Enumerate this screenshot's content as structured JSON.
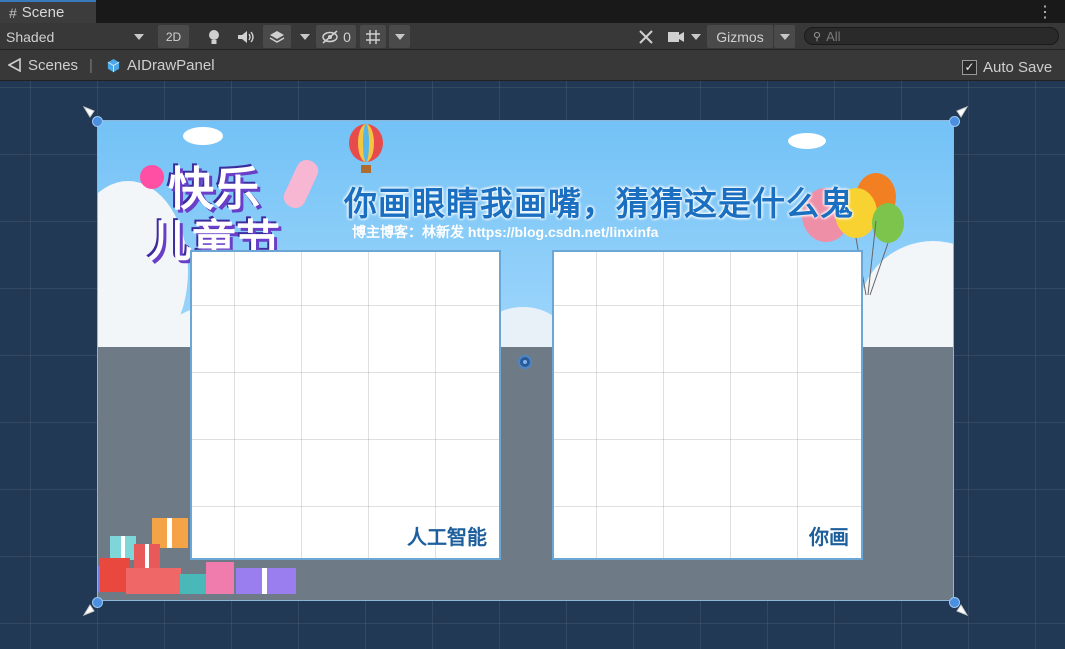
{
  "tab": {
    "icon": "grid-icon",
    "label": "Scene"
  },
  "toolbar": {
    "shading_mode": "Shaded",
    "mode_2d": "2D",
    "hidden_count": "0",
    "gizmos_label": "Gizmos",
    "search_placeholder": "All"
  },
  "breadcrumb": {
    "scenes_label": "Scenes",
    "separator": "|",
    "prefab_label": "AIDrawPanel",
    "auto_save_label": "Auto Save",
    "auto_save_checked": true
  },
  "canvas": {
    "logo_line1": "快乐",
    "logo_line2": "儿童节",
    "title": "你画眼睛我画嘴，猜猜这是什么鬼",
    "subtitle": "博主博客：林新发 https://blog.csdn.net/linxinfa",
    "left_panel_label": "人工智能",
    "right_panel_label": "你画"
  },
  "colors": {
    "accent": "#3a79bb",
    "scene_bg": "#213954",
    "sky": "#73c2f6",
    "title_blue": "#1a6fc0",
    "ground": "#6e7a86"
  }
}
